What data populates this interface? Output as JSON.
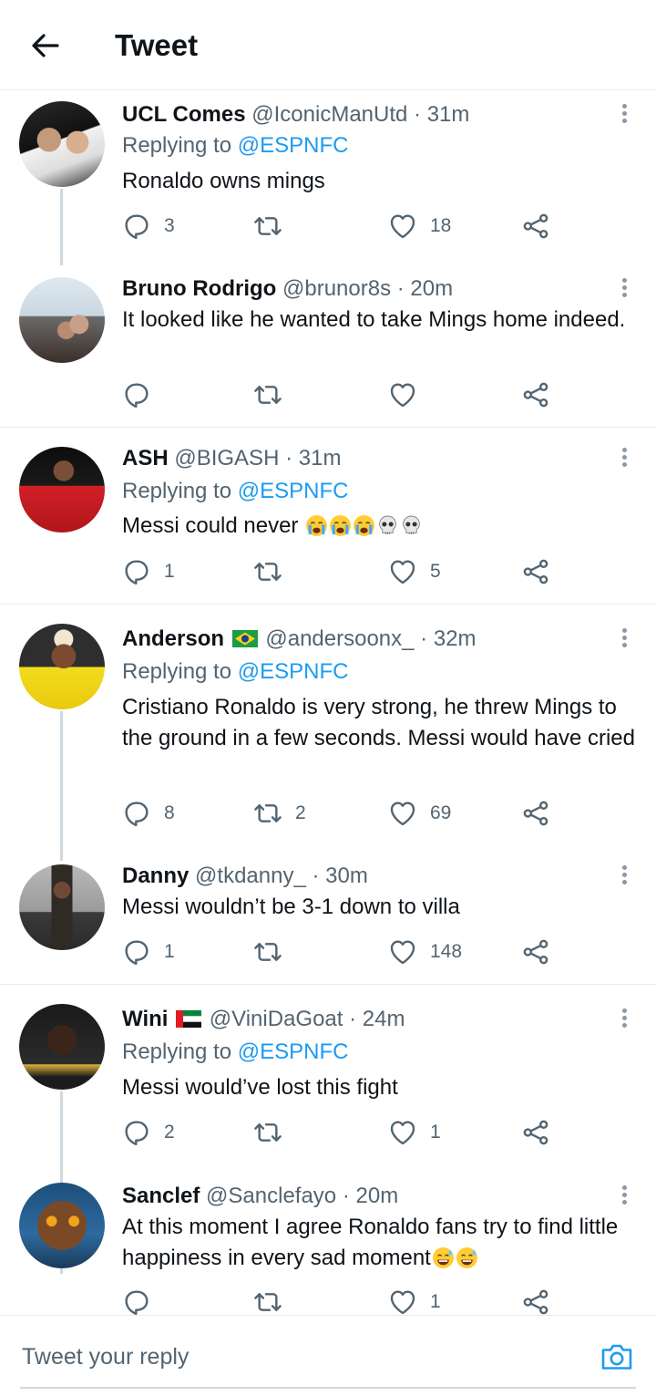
{
  "header": {
    "title": "Tweet"
  },
  "tweets": [
    {
      "name": "UCL Comes",
      "handle": "@IconicManUtd",
      "time": "31m",
      "replying_prefix": "Replying to",
      "replying_to": "@ESPNFC",
      "text": "Ronaldo owns mings",
      "replies": "3",
      "retweets": "",
      "likes": "18"
    },
    {
      "name": "Bruno Rodrigo",
      "handle": "@brunor8s",
      "time": "20m",
      "text": "It looked like he wanted to take Mings home indeed.",
      "replies": "",
      "retweets": "",
      "likes": ""
    },
    {
      "name": "ASH",
      "handle": "@BIGASH",
      "time": "31m",
      "replying_prefix": "Replying to",
      "replying_to": "@ESPNFC",
      "text": "Messi could never ",
      "replies": "1",
      "retweets": "",
      "likes": "5"
    },
    {
      "name": "Anderson",
      "handle": "@andersoonx_",
      "time": "32m",
      "replying_prefix": "Replying to",
      "replying_to": "@ESPNFC",
      "text": "Cristiano Ronaldo is very strong, he threw Mings to the ground in a few seconds. Messi would have cried",
      "replies": "8",
      "retweets": "2",
      "likes": "69"
    },
    {
      "name": "Danny",
      "handle": "@tkdanny_",
      "time": "30m",
      "text": "Messi wouldn’t be 3-1 down to villa",
      "replies": "1",
      "retweets": "",
      "likes": "148"
    },
    {
      "name": "Wini",
      "handle": "@ViniDaGoat",
      "time": "24m",
      "replying_prefix": "Replying to",
      "replying_to": "@ESPNFC",
      "text": "Messi would’ve lost this fight",
      "replies": "2",
      "retweets": "",
      "likes": "1"
    },
    {
      "name": "Sanclef",
      "handle": "@Sanclefayo",
      "time": "20m",
      "text": "At this moment I agree Ronaldo fans try to find little happiness in every sad moment",
      "replies": "",
      "retweets": "",
      "likes": "1"
    }
  ],
  "separator": "·",
  "reply_bar": {
    "placeholder": "Tweet your reply"
  },
  "colors": {
    "link": "#1d9bf0",
    "secondary_text": "#536471",
    "divider": "#e6ecf0",
    "thread_line": "#cfd9de"
  },
  "icons": [
    "back-arrow-icon",
    "more-vertical-icon",
    "reply-icon",
    "retweet-icon",
    "like-icon",
    "share-icon",
    "camera-icon",
    "brazil-flag-icon",
    "uae-flag-icon",
    "crying-emoji-icon",
    "skull-emoji-icon",
    "sweat-smile-emoji-icon"
  ]
}
